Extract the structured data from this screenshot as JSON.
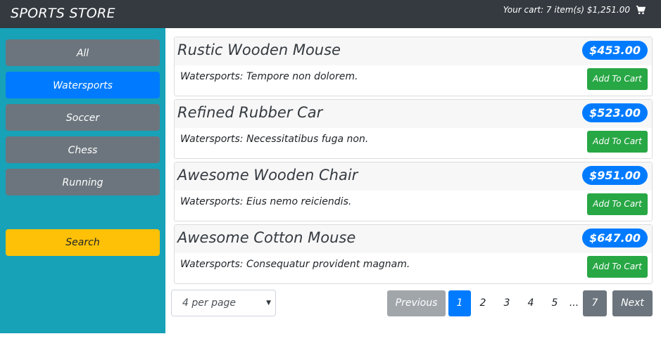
{
  "navbar": {
    "brand": "SPORTS STORE",
    "cart_summary": "Your cart: 7 item(s) $1,251.00",
    "cart_icon": "shopping-cart-icon"
  },
  "sidebar": {
    "categories": [
      {
        "label": "All",
        "active": false
      },
      {
        "label": "Watersports",
        "active": true
      },
      {
        "label": "Soccer",
        "active": false
      },
      {
        "label": "Chess",
        "active": false
      },
      {
        "label": "Running",
        "active": false
      }
    ],
    "search_label": "Search"
  },
  "products": [
    {
      "name": "Rustic Wooden Mouse",
      "price": "$453.00",
      "description": "Watersports: Tempore non dolorem.",
      "button": "Add To Cart"
    },
    {
      "name": "Refined Rubber Car",
      "price": "$523.00",
      "description": "Watersports: Necessitatibus fuga non.",
      "button": "Add To Cart"
    },
    {
      "name": "Awesome Wooden Chair",
      "price": "$951.00",
      "description": "Watersports: Eius nemo reiciendis.",
      "button": "Add To Cart"
    },
    {
      "name": "Awesome Cotton Mouse",
      "price": "$647.00",
      "description": "Watersports: Consequatur provident magnam.",
      "button": "Add To Cart"
    }
  ],
  "pagination": {
    "per_page": "4 per page",
    "previous": "Previous",
    "pages": [
      "1",
      "2",
      "3",
      "4",
      "5"
    ],
    "current_page": "1",
    "ellipsis": "...",
    "last_page": "7",
    "next": "Next"
  },
  "colors": {
    "navbar": "#343a40",
    "sidebar": "#17a2b8",
    "category": "#6c757d",
    "category_active": "#007bff",
    "search": "#ffc107",
    "price_badge": "#007bff",
    "add_to_cart": "#28a745"
  }
}
